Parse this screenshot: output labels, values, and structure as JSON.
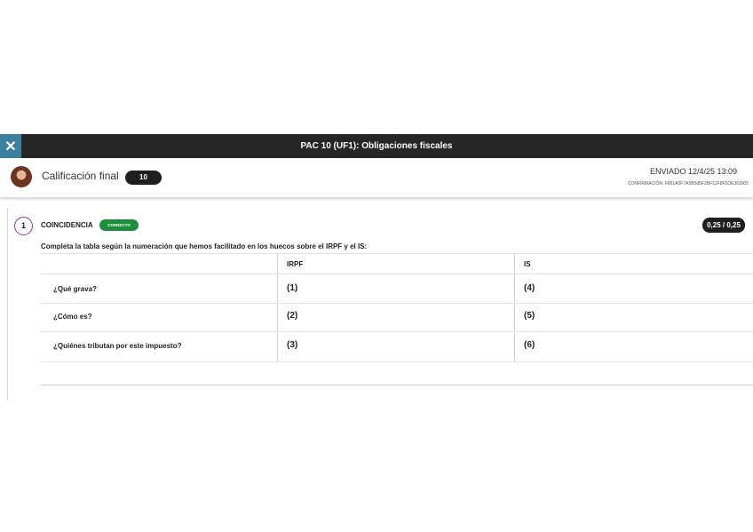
{
  "window": {
    "close_icon": "close-icon",
    "close_glyph": "✕",
    "title": "PAC 10 (UF1): Obligaciones fiscales"
  },
  "grade": {
    "label": "Calificación final",
    "value": "10",
    "sent": "ENVIADO 12/4/25 13:09",
    "confirmation": "CONFIRMACIÓN: F861A0F7A5B5d5F2BF12F8F5DE363005"
  },
  "question": {
    "number": "1",
    "type": "COINCIDENCIA",
    "status": "CORRECTO",
    "status_color": "#1e8e3e",
    "score": "0,25 / 0,25",
    "instruction": "Completa la tabla según la numeración que hemos facilitado en los huecos sobre el IRPF y el IS:",
    "table": {
      "headers": [
        "",
        "IRPF",
        "IS"
      ],
      "rows": [
        {
          "label": "¿Qué grava?",
          "irpf": "(1)",
          "is": "(4)"
        },
        {
          "label": "¿Cómo es?",
          "irpf": "(2)",
          "is": "(5)"
        },
        {
          "label": "¿Quiénes tributan por este impuesto?",
          "irpf": "(3)",
          "is": "(6)"
        }
      ]
    }
  },
  "colors": {
    "titlebar": "#262626",
    "close_button": "#3d7f9e",
    "question_ring": "#8a3c8e"
  }
}
